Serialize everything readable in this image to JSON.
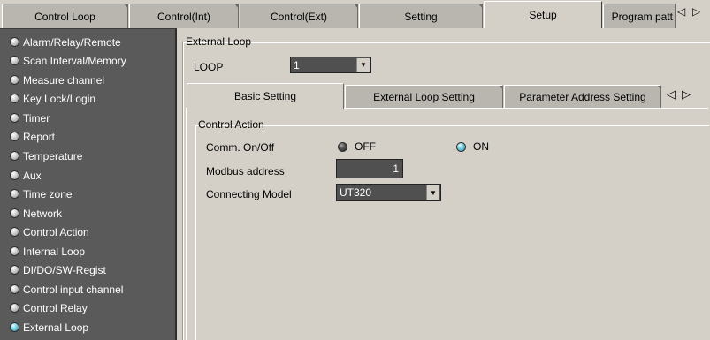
{
  "top_tabs": [
    {
      "label": "Control Loop"
    },
    {
      "label": "Control(Int)"
    },
    {
      "label": "Control(Ext)"
    },
    {
      "label": "Setting"
    },
    {
      "label": "Setup"
    },
    {
      "label": "Program patt"
    }
  ],
  "top_scroll": {
    "left": "◁",
    "right": "▷"
  },
  "sidebar": {
    "items": [
      {
        "label": "Alarm/Relay/Remote"
      },
      {
        "label": "Scan Interval/Memory"
      },
      {
        "label": "Measure channel"
      },
      {
        "label": "Key Lock/Login"
      },
      {
        "label": "Timer"
      },
      {
        "label": "Report"
      },
      {
        "label": "Temperature"
      },
      {
        "label": "Aux"
      },
      {
        "label": "Time zone"
      },
      {
        "label": "Network"
      },
      {
        "label": "Control Action"
      },
      {
        "label": "Internal Loop"
      },
      {
        "label": "DI/DO/SW-Regist"
      },
      {
        "label": "Control input channel"
      },
      {
        "label": "Control Relay"
      },
      {
        "label": "External Loop"
      }
    ],
    "selected": "External Loop"
  },
  "main": {
    "group_title": "External Loop",
    "loop_label": "LOOP",
    "loop_value": "1",
    "inner_tabs": [
      {
        "label": "Basic Setting"
      },
      {
        "label": "External Loop Setting"
      },
      {
        "label": "Parameter Address Setting"
      }
    ],
    "inner_scroll": {
      "left": "◁",
      "right": "▷"
    },
    "control_action": {
      "title": "Control Action",
      "comm_label": "Comm. On/Off",
      "off_label": "OFF",
      "on_label": "ON",
      "comm_selected": "ON",
      "modbus_label": "Modbus address",
      "modbus_value": "1",
      "model_label": "Connecting Model",
      "model_value": "UT320"
    }
  },
  "colors": {
    "sidebar_bg": "#5a5a5a",
    "led_on": "#7bd3e2",
    "field_bg": "#505050",
    "panel_bg": "#d4d0c8"
  }
}
